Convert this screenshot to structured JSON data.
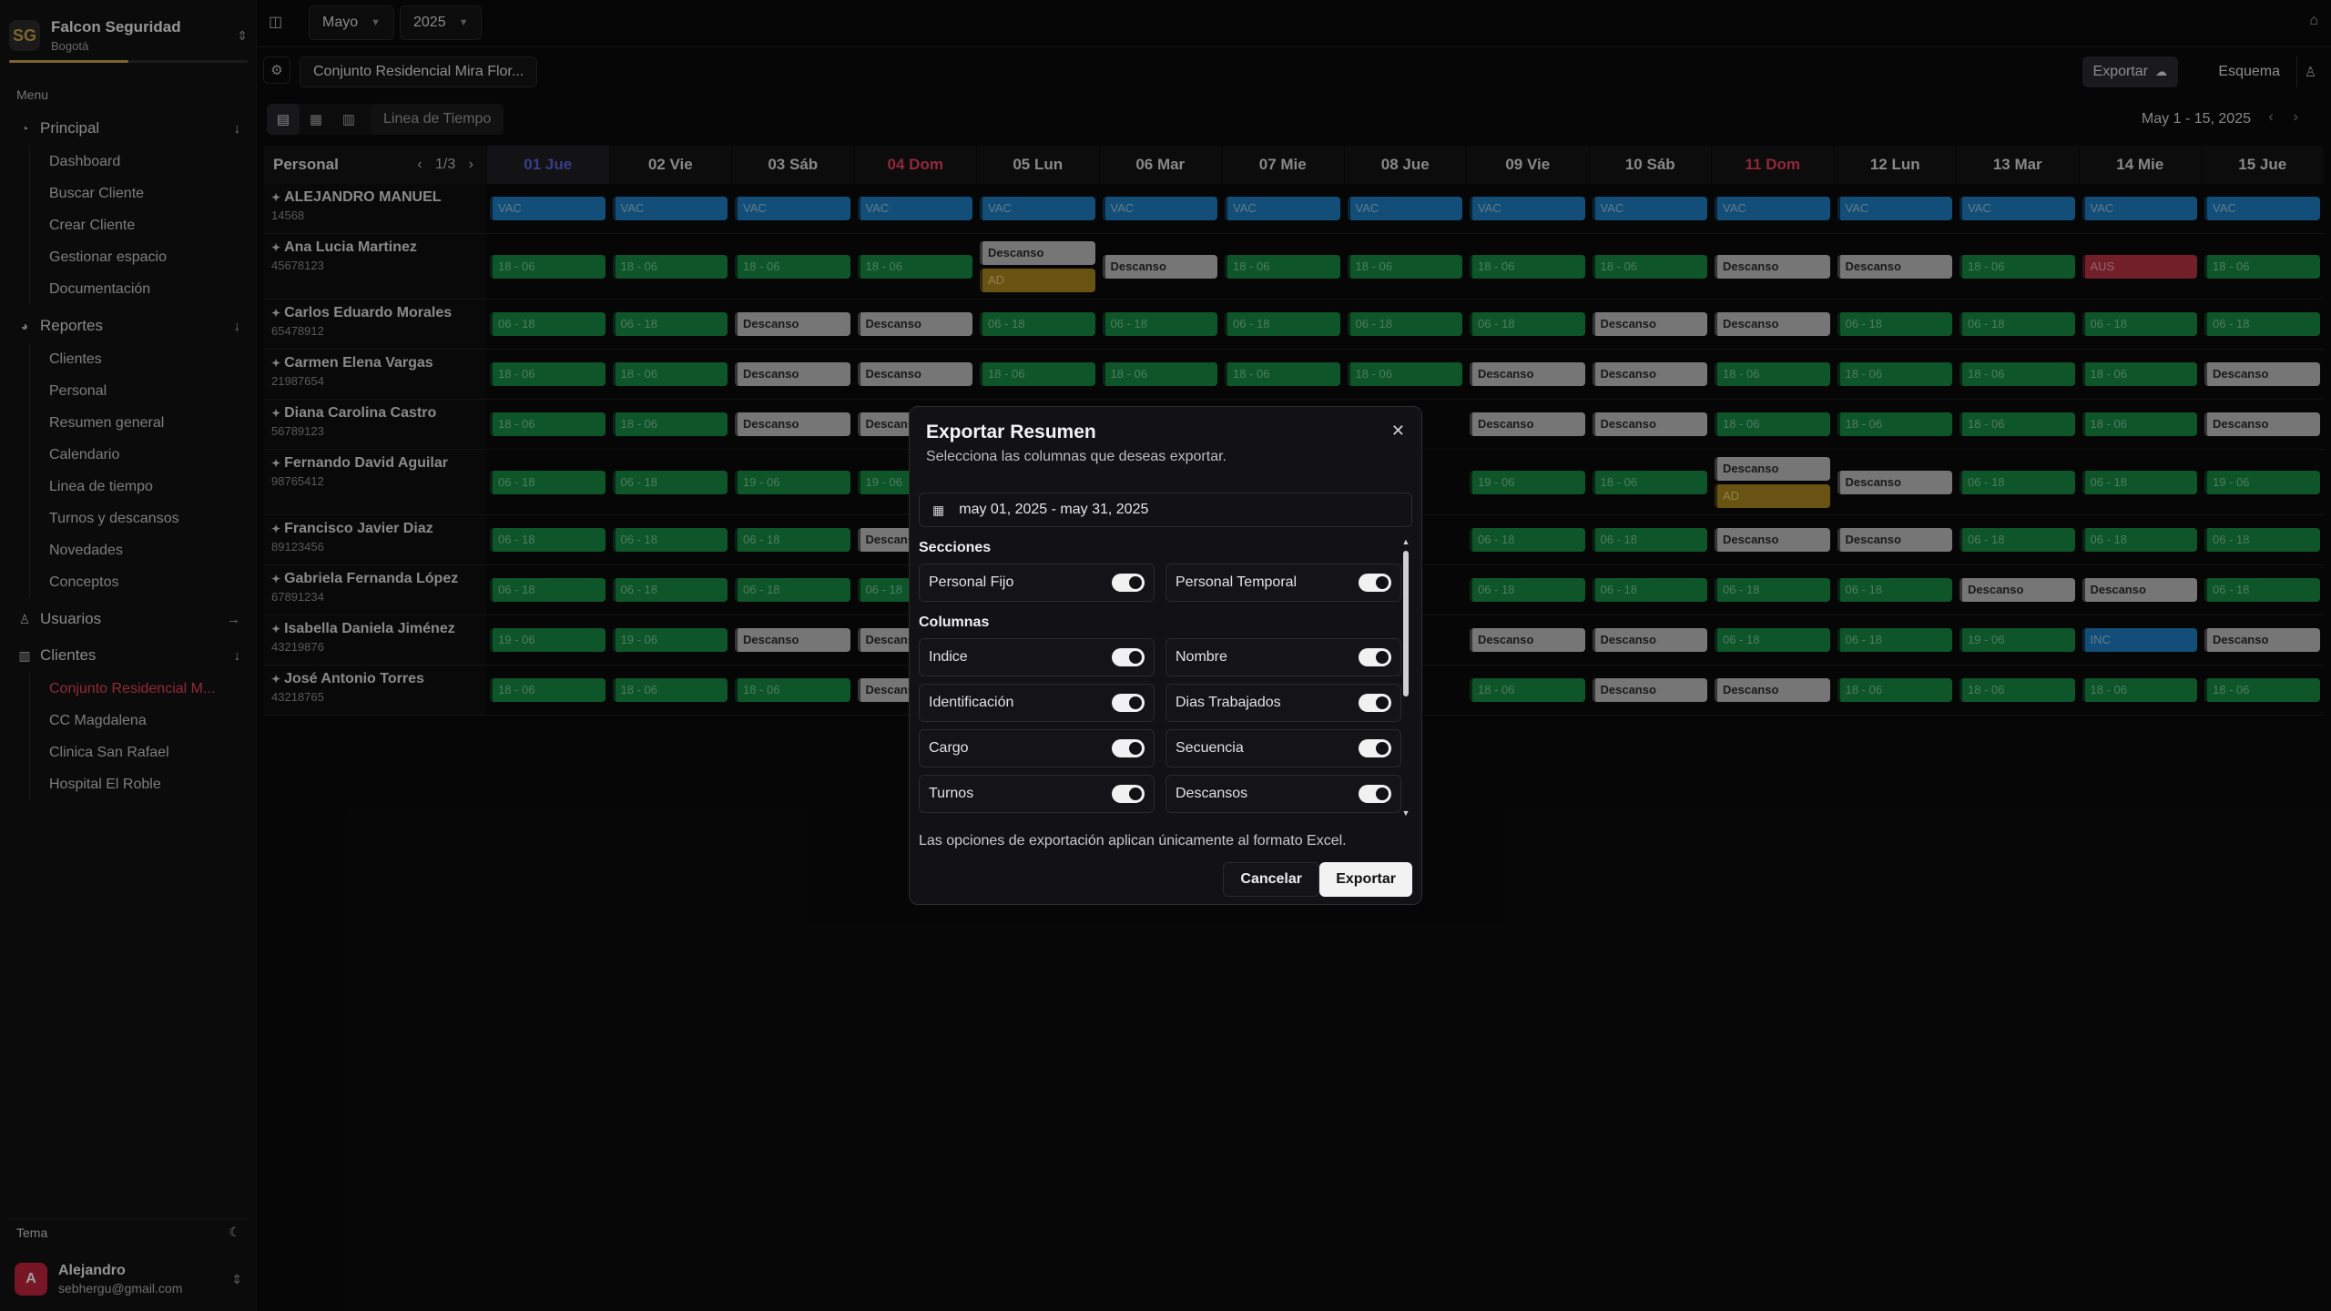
{
  "org": {
    "name": "Falcon Seguridad",
    "city": "Bogotá",
    "logo": "SG"
  },
  "menu_caption": "Menu",
  "nav": {
    "principal": {
      "label": "Principal",
      "items": [
        "Dashboard",
        "Buscar Cliente",
        "Crear Cliente",
        "Gestionar espacio",
        "Documentación"
      ]
    },
    "reportes": {
      "label": "Reportes",
      "items": [
        "Clientes",
        "Personal",
        "Resumen general",
        "Calendario",
        "Linea de tiempo",
        "Turnos y descansos",
        "Novedades",
        "Conceptos"
      ]
    },
    "usuarios": {
      "label": "Usuarios"
    },
    "clientes": {
      "label": "Clientes",
      "items": [
        "Conjunto Residencial M...",
        "CC Magdalena",
        "Clinica San Rafael",
        "Hospital El Roble"
      ],
      "active_index": 0
    }
  },
  "tema_label": "Tema",
  "user": {
    "initial": "A",
    "name": "Alejandro",
    "email": "sebhergu@gmail.com"
  },
  "topbar": {
    "month": "Mayo",
    "year": "2025"
  },
  "toolbar": {
    "client": "Conjunto Residencial Mira Flor...",
    "export": "Exportar",
    "schema": "Esquema"
  },
  "view": {
    "label": "Linea de Tiempo",
    "range": "May 1 - 15, 2025"
  },
  "grid": {
    "personal_label": "Personal",
    "page": "1/3",
    "days": [
      "01 Jue",
      "02 Vie",
      "03 Sáb",
      "04 Dom",
      "05 Lun",
      "06 Mar",
      "07 Mie",
      "08 Jue",
      "09 Vie",
      "10 Sáb",
      "11 Dom",
      "12 Lun",
      "13 Mar",
      "14 Mie",
      "15 Jue"
    ],
    "selected_day": 0,
    "sunday_days": [
      3,
      10
    ],
    "rows": [
      {
        "name": "ALEJANDRO MANUEL",
        "id": "14568",
        "cells": [
          [
            "VAC"
          ],
          [
            "VAC"
          ],
          [
            "VAC"
          ],
          [
            "VAC"
          ],
          [
            "VAC"
          ],
          [
            "VAC"
          ],
          [
            "VAC"
          ],
          [
            "VAC"
          ],
          [
            "VAC"
          ],
          [
            "VAC"
          ],
          [
            "VAC"
          ],
          [
            "VAC"
          ],
          [
            "VAC"
          ],
          [
            "VAC"
          ],
          [
            "VAC"
          ]
        ]
      },
      {
        "name": "Ana Lucia Martinez",
        "id": "45678123",
        "cells": [
          [
            "18 - 06"
          ],
          [
            "18 - 06"
          ],
          [
            "18 - 06"
          ],
          [
            "18 - 06"
          ],
          [
            "Descanso",
            "AD"
          ],
          [
            "Descanso"
          ],
          [
            "18 - 06"
          ],
          [
            "18 - 06"
          ],
          [
            "18 - 06"
          ],
          [
            "18 - 06"
          ],
          [
            "Descanso"
          ],
          [
            "Descanso"
          ],
          [
            "18 - 06"
          ],
          [
            "AUS"
          ],
          [
            "18 - 06"
          ]
        ]
      },
      {
        "name": "Carlos Eduardo Morales",
        "id": "65478912",
        "cells": [
          [
            "06 - 18"
          ],
          [
            "06 - 18"
          ],
          [
            "Descanso"
          ],
          [
            "Descanso"
          ],
          [
            "06 - 18"
          ],
          [
            "06 - 18"
          ],
          [
            "06 - 18"
          ],
          [
            "06 - 18"
          ],
          [
            "06 - 18"
          ],
          [
            "Descanso"
          ],
          [
            "Descanso"
          ],
          [
            "06 - 18"
          ],
          [
            "06 - 18"
          ],
          [
            "06 - 18"
          ],
          [
            "06 - 18"
          ]
        ]
      },
      {
        "name": "Carmen Elena Vargas",
        "id": "21987654",
        "cells": [
          [
            "18 - 06"
          ],
          [
            "18 - 06"
          ],
          [
            "Descanso"
          ],
          [
            "Descanso"
          ],
          [
            "18 - 06"
          ],
          [
            "18 - 06"
          ],
          [
            "18 - 06"
          ],
          [
            "18 - 06"
          ],
          [
            "Descanso"
          ],
          [
            "Descanso"
          ],
          [
            "18 - 06"
          ],
          [
            "18 - 06"
          ],
          [
            "18 - 06"
          ],
          [
            "18 - 06"
          ],
          [
            "Descanso"
          ]
        ]
      },
      {
        "name": "Diana Carolina Castro",
        "id": "56789123",
        "cells": [
          [
            "18 - 06"
          ],
          [
            "18 - 06"
          ],
          [
            "Descanso"
          ],
          [
            "Descanso"
          ],
          [],
          [],
          [],
          [],
          [
            "Descanso"
          ],
          [
            "Descanso"
          ],
          [
            "18 - 06"
          ],
          [
            "18 - 06"
          ],
          [
            "18 - 06"
          ],
          [
            "18 - 06"
          ],
          [
            "Descanso"
          ]
        ]
      },
      {
        "name": "Fernando David Aguilar",
        "id": "98765412",
        "cells": [
          [
            "06 - 18"
          ],
          [
            "06 - 18"
          ],
          [
            "19 - 06"
          ],
          [
            "19 - 06"
          ],
          [],
          [],
          [],
          [],
          [
            "19 - 06"
          ],
          [
            "18 - 06"
          ],
          [
            "Descanso",
            "AD"
          ],
          [
            "Descanso"
          ],
          [
            "06 - 18"
          ],
          [
            "06 - 18"
          ],
          [
            "19 - 06"
          ]
        ]
      },
      {
        "name": "Francisco Javier Diaz",
        "id": "89123456",
        "cells": [
          [
            "06 - 18"
          ],
          [
            "06 - 18"
          ],
          [
            "06 - 18"
          ],
          [
            "Descanso"
          ],
          [],
          [],
          [],
          [],
          [
            "06 - 18"
          ],
          [
            "06 - 18"
          ],
          [
            "Descanso"
          ],
          [
            "Descanso"
          ],
          [
            "06 - 18"
          ],
          [
            "06 - 18"
          ],
          [
            "06 - 18"
          ]
        ]
      },
      {
        "name": "Gabriela Fernanda López",
        "id": "67891234",
        "cells": [
          [
            "06 - 18"
          ],
          [
            "06 - 18"
          ],
          [
            "06 - 18"
          ],
          [
            "06 - 18"
          ],
          [],
          [],
          [],
          [],
          [
            "06 - 18"
          ],
          [
            "06 - 18"
          ],
          [
            "06 - 18"
          ],
          [
            "06 - 18"
          ],
          [
            "Descanso"
          ],
          [
            "Descanso"
          ],
          [
            "06 - 18"
          ]
        ]
      },
      {
        "name": "Isabella Daniela Jiménez",
        "id": "43219876",
        "cells": [
          [
            "19 - 06"
          ],
          [
            "19 - 06"
          ],
          [
            "Descanso"
          ],
          [
            "Descanso"
          ],
          [],
          [],
          [],
          [],
          [
            "Descanso"
          ],
          [
            "Descanso"
          ],
          [
            "06 - 18"
          ],
          [
            "06 - 18"
          ],
          [
            "19 - 06"
          ],
          [
            "INC"
          ],
          [
            "Descanso"
          ]
        ]
      },
      {
        "name": "José Antonio Torres",
        "id": "43218765",
        "cells": [
          [
            "18 - 06"
          ],
          [
            "18 - 06"
          ],
          [
            "18 - 06"
          ],
          [
            "Descanso"
          ],
          [],
          [],
          [],
          [],
          [
            "18 - 06"
          ],
          [
            "Descanso"
          ],
          [
            "Descanso"
          ],
          [
            "18 - 06"
          ],
          [
            "18 - 06"
          ],
          [
            "18 - 06"
          ],
          [
            "18 - 06"
          ]
        ]
      }
    ]
  },
  "modal": {
    "title": "Exportar Resumen",
    "subtitle": "Selecciona las columnas que deseas exportar.",
    "date_range": "may 01, 2025 - may 31, 2025",
    "sections_label": "Secciones",
    "sections": [
      "Personal Fijo",
      "Personal Temporal"
    ],
    "columns_label": "Columnas",
    "columns": [
      "Indice",
      "Nombre",
      "Identificación",
      "Dias Trabajados",
      "Cargo",
      "Secuencia",
      "Turnos",
      "Descansos"
    ],
    "note": "Las opciones de exportación aplican únicamente al formato Excel.",
    "cancel": "Cancelar",
    "export": "Exportar"
  }
}
